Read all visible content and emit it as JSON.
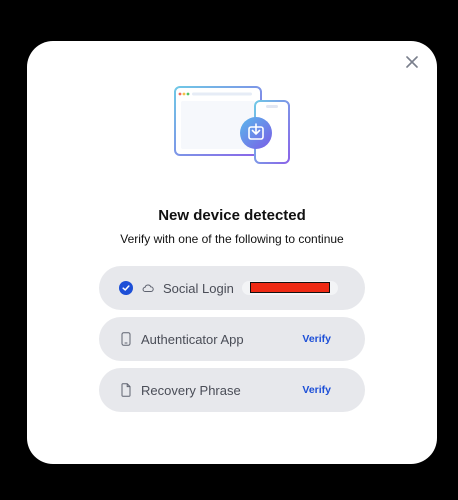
{
  "dialog": {
    "title": "New device detected",
    "subtitle": "Verify with one of the following to continue"
  },
  "options": [
    {
      "label": "Social Login",
      "icon": "cloud-icon",
      "selected": true
    },
    {
      "label": "Authenticator App",
      "icon": "phone-icon",
      "action": "Verify"
    },
    {
      "label": "Recovery Phrase",
      "icon": "document-icon",
      "action": "Verify"
    }
  ],
  "icons": {
    "close": "close-icon",
    "illustration": "device-transfer-illustration",
    "selected": "check-circle-icon"
  },
  "colors": {
    "accent": "#1d4fd7",
    "option_bg": "#e7e8ec",
    "redaction": "#ee2a14"
  }
}
